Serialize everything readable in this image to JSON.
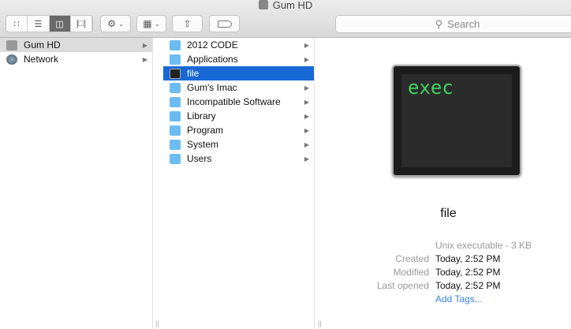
{
  "window": {
    "title": "Gum HD"
  },
  "toolbar": {
    "views": [
      "icon-view",
      "list-view",
      "column-view",
      "cover-flow-view"
    ],
    "search_placeholder": "Search"
  },
  "sidebar": [
    {
      "label": "Gum HD"
    },
    {
      "label": "Network"
    }
  ],
  "column2": [
    {
      "label": "2012 CODE"
    },
    {
      "label": "Applications"
    },
    {
      "label": "file",
      "selected": true
    },
    {
      "label": "Gum's Imac"
    },
    {
      "label": "Incompatible Software"
    },
    {
      "label": "Library"
    },
    {
      "label": "Program"
    },
    {
      "label": "System"
    },
    {
      "label": "Users"
    }
  ],
  "preview": {
    "icon_text": "exec",
    "name": "file",
    "kind": "Unix executable - 3 KB",
    "created_label": "Created",
    "created": "Today, 2:52 PM",
    "modified_label": "Modified",
    "modified": "Today, 2:52 PM",
    "opened_label": "Last opened",
    "opened": "Today, 2:52 PM",
    "add_tags": "Add Tags..."
  }
}
